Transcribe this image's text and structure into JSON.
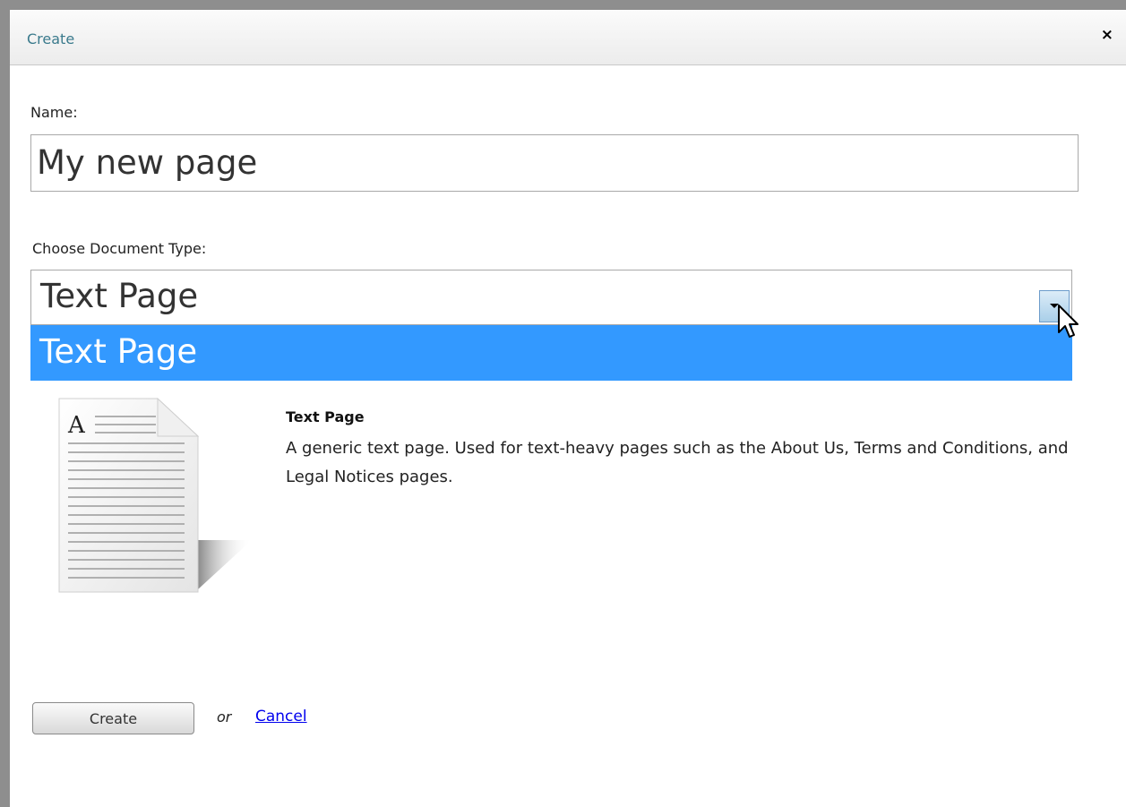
{
  "dialog": {
    "title": "Create",
    "close_label": "×"
  },
  "form": {
    "name_label": "Name:",
    "name_value": "My new page",
    "doctype_label": "Choose Document Type:",
    "doctype_selected": "Text Page",
    "doctype_options": [
      "Text Page"
    ]
  },
  "description": {
    "title": "Text Page",
    "text": "A generic text page. Used for text-heavy pages such as the About Us, Terms and Conditions, and Legal Notices pages.",
    "icon": "text-page-document-icon",
    "icon_letter": "A"
  },
  "actions": {
    "create_label": "Create",
    "or_text": "or",
    "cancel_label": "Cancel"
  },
  "colors": {
    "title": "#3a7a8c",
    "highlight": "#3399ff",
    "link": "#0000ee",
    "window_border": "#8e8e8e"
  }
}
